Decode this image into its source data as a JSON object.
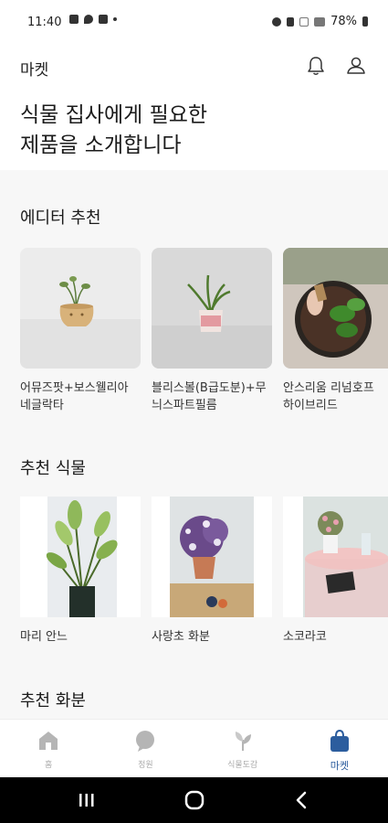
{
  "status_bar": {
    "time": "11:40",
    "battery": "78%"
  },
  "header": {
    "title": "마켓",
    "icons": [
      "bell-icon",
      "user-icon"
    ]
  },
  "hero": {
    "text": "식물 집사에게 필요한\n제품을 소개합니다"
  },
  "sections": {
    "editor": {
      "title": "에디터 추천",
      "items": [
        {
          "label": "어뮤즈팟+보스웰리아\n네글락타"
        },
        {
          "label": "블리스볼(B급도분)+무\n늬스파트필름"
        },
        {
          "label": "안스리움 리넘호프\n하이브리드"
        }
      ]
    },
    "plants": {
      "title": "추천 식물",
      "items": [
        {
          "label": "마리 안느"
        },
        {
          "label": "사랑초 화분"
        },
        {
          "label": "소코라코"
        }
      ]
    },
    "pots": {
      "title": "추천 화분"
    }
  },
  "bottom_nav": {
    "items": [
      {
        "label": "홈",
        "icon": "home-icon",
        "active": false
      },
      {
        "label": "정원",
        "icon": "chat-icon",
        "active": false
      },
      {
        "label": "식물도감",
        "icon": "leaf-icon",
        "active": false
      },
      {
        "label": "마켓",
        "icon": "bag-icon",
        "active": true
      }
    ]
  },
  "colors": {
    "accent": "#2c5d9e",
    "inactive": "#b5b5b5"
  }
}
